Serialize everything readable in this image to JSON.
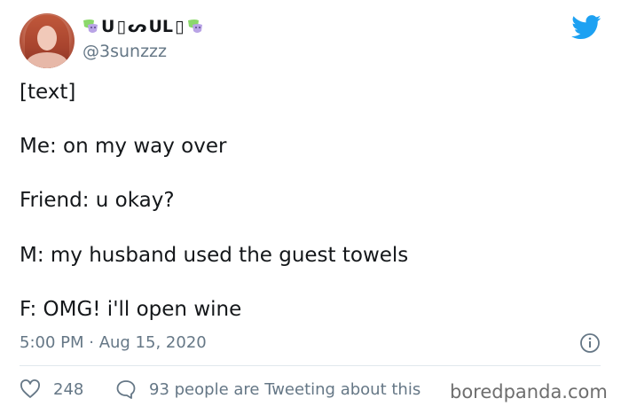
{
  "author": {
    "display_name_parts": [
      "U",
      "▯",
      "ᔕ",
      "UL",
      "▯"
    ],
    "handle": "@3sunzzz"
  },
  "tweet": {
    "lines": [
      "[text]",
      "Me: on my way over",
      "Friend: u okay?",
      "M: my husband used the guest towels",
      "F: OMG! i'll open wine"
    ],
    "timestamp": "5:00 PM · Aug 15, 2020"
  },
  "engagement": {
    "likes": "248",
    "tweeting_about": "93 people are Tweeting about this"
  },
  "watermark": "boredpanda.com",
  "colors": {
    "twitter_blue": "#1da1f2",
    "secondary_text": "#657786",
    "divider": "#e1e8ed",
    "mask_green": "#8bd86b",
    "mask_purple": "#b9a4e6"
  },
  "icons": [
    "theater-mask-icon",
    "twitter-bird-icon",
    "info-icon",
    "heart-icon",
    "speech-bubble-icon"
  ]
}
